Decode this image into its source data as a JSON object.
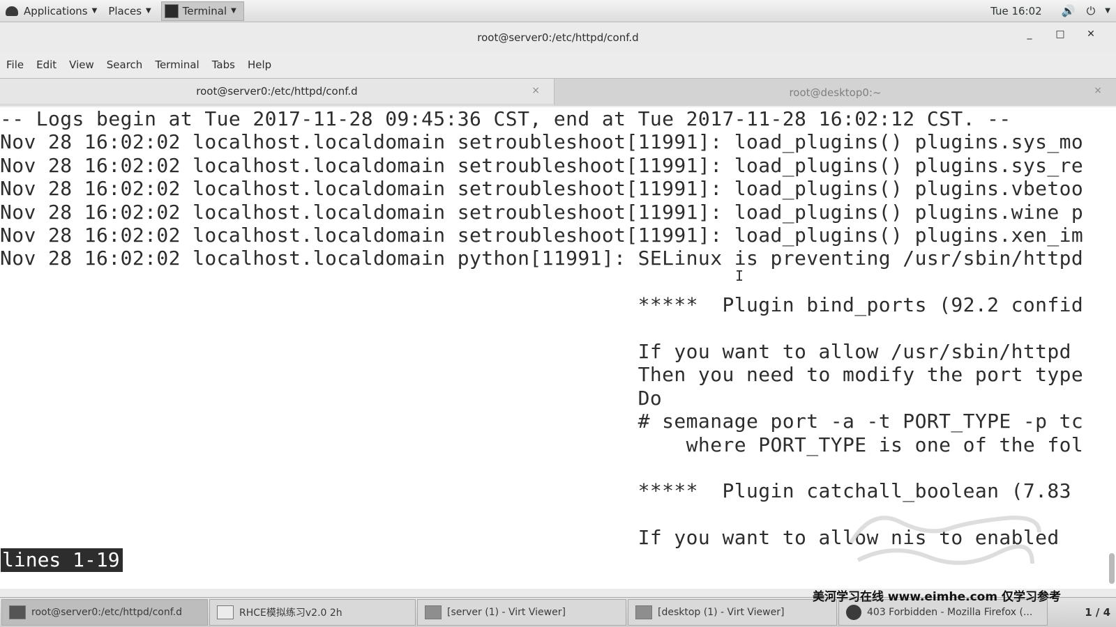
{
  "top_panel": {
    "applications_label": "Applications",
    "places_label": "Places",
    "terminal_label": "Terminal",
    "clock": "Tue 16:02"
  },
  "window": {
    "title": "root@server0:/etc/httpd/conf.d",
    "minimize": "_",
    "maximize": "□",
    "close": "✕"
  },
  "menu": [
    "File",
    "Edit",
    "View",
    "Search",
    "Terminal",
    "Tabs",
    "Help"
  ],
  "tabs": [
    {
      "label": "root@server0:/etc/httpd/conf.d",
      "active": true,
      "close": "×"
    },
    {
      "label": "root@desktop0:~",
      "active": false,
      "close": "×"
    }
  ],
  "terminal": {
    "lines": [
      "-- Logs begin at Tue 2017-11-28 09:45:36 CST, end at Tue 2017-11-28 16:02:12 CST. --",
      "Nov 28 16:02:02 localhost.localdomain setroubleshoot[11991]: load_plugins() plugins.sys_mo",
      "Nov 28 16:02:02 localhost.localdomain setroubleshoot[11991]: load_plugins() plugins.sys_re",
      "Nov 28 16:02:02 localhost.localdomain setroubleshoot[11991]: load_plugins() plugins.vbetoo",
      "Nov 28 16:02:02 localhost.localdomain setroubleshoot[11991]: load_plugins() plugins.wine p",
      "Nov 28 16:02:02 localhost.localdomain setroubleshoot[11991]: load_plugins() plugins.xen_im",
      "Nov 28 16:02:02 localhost.localdomain python[11991]: SELinux is preventing /usr/sbin/httpd",
      "",
      "                                                     *****  Plugin bind_ports (92.2 confid",
      "",
      "                                                     If you want to allow /usr/sbin/httpd",
      "                                                     Then you need to modify the port type",
      "                                                     Do",
      "                                                     # semanage port -a -t PORT_TYPE -p tc",
      "                                                         where PORT_TYPE is one of the fol",
      "",
      "                                                     *****  Plugin catchall_boolean (7.83",
      "",
      "                                                     If you want to allow nis to enabled"
    ],
    "pager_status": "lines 1-19"
  },
  "taskbar": {
    "items": [
      {
        "label": "root@server0:/etc/httpd/conf.d",
        "icon": "terminal-icon",
        "active": true
      },
      {
        "label": "RHCE模拟练习v2.0 2h",
        "icon": "document-icon",
        "active": false
      },
      {
        "label": "[server (1) - Virt Viewer]",
        "icon": "virt-viewer-icon",
        "active": false
      },
      {
        "label": "[desktop (1) - Virt Viewer]",
        "icon": "virt-viewer-icon",
        "active": false
      },
      {
        "label": "403 Forbidden - Mozilla Firefox (...",
        "icon": "firefox-icon",
        "active": false
      }
    ],
    "workspace": "1 / 4",
    "overlay_text": "美河学习在线 www.eimhe.com 仅学习参考"
  }
}
